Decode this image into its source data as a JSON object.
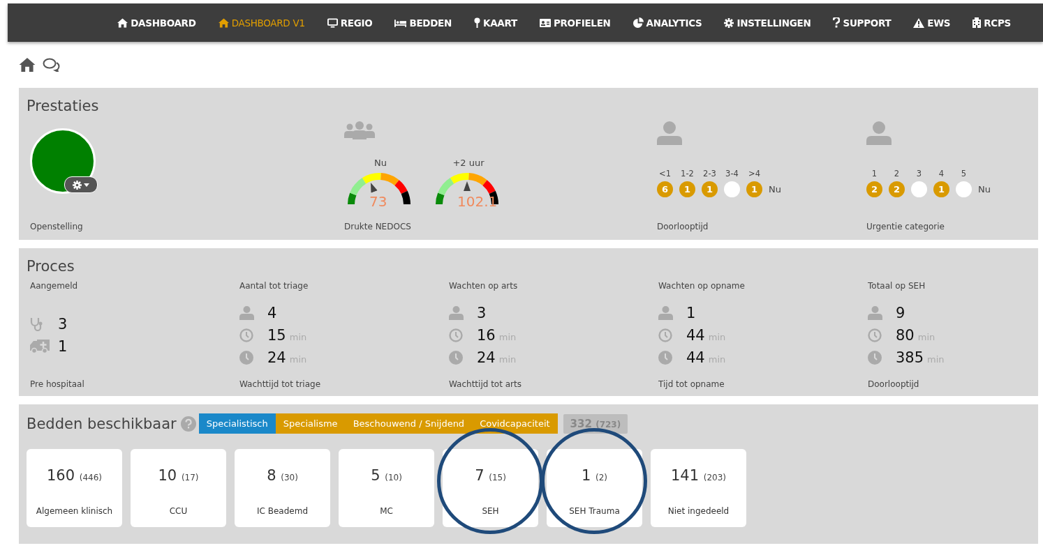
{
  "nav": [
    {
      "kind": "home",
      "label": "DASHBOARD",
      "selected": false
    },
    {
      "kind": "home",
      "label": "DASHBOARD V1",
      "selected": true
    },
    {
      "kind": "monitor",
      "label": "REGIO",
      "selected": false
    },
    {
      "kind": "bed",
      "label": "BEDDEN",
      "selected": false
    },
    {
      "kind": "pin",
      "label": "KAART",
      "selected": false
    },
    {
      "kind": "card",
      "label": "PROFIELEN",
      "selected": false
    },
    {
      "kind": "pie",
      "label": "ANALYTICS",
      "selected": false
    },
    {
      "kind": "gear",
      "label": "INSTELLINGEN",
      "selected": false
    },
    {
      "kind": "question",
      "label": "SUPPORT",
      "selected": false
    },
    {
      "kind": "warning",
      "label": "EWS",
      "selected": false
    },
    {
      "kind": "building",
      "label": "RCPS",
      "selected": false
    }
  ],
  "prestaties": {
    "title": "Prestaties",
    "openstelling": {
      "color": "#008000",
      "label": "Openstelling"
    },
    "drukte": {
      "label": "Drukte NEDOCS",
      "gauges": [
        {
          "caption": "Nu",
          "value": "73"
        },
        {
          "caption": "+2 uur",
          "value": "102.1"
        }
      ]
    },
    "doorlooptijd": {
      "label": "Doorlooptijd",
      "now": "Nu",
      "buckets": [
        {
          "label": "<1",
          "count": "6"
        },
        {
          "label": "1-2",
          "count": "1"
        },
        {
          "label": "2-3",
          "count": "1"
        },
        {
          "label": "3-4"
        },
        {
          "label": ">4",
          "count": "1"
        }
      ]
    },
    "urgentie": {
      "label": "Urgentie categorie",
      "now": "Nu",
      "buckets": [
        {
          "label": "1",
          "count": "2"
        },
        {
          "label": "2",
          "count": "2"
        },
        {
          "label": "3"
        },
        {
          "label": "4",
          "count": "1"
        },
        {
          "label": "5"
        }
      ]
    }
  },
  "proces": {
    "title": "Proces",
    "columns": [
      {
        "title": "Aangemeld",
        "footer": "Pre hospitaal",
        "rows": [
          {
            "kind": "stethoscope",
            "value": "3"
          },
          {
            "kind": "ambulance",
            "value": "1"
          }
        ]
      },
      {
        "title": "Aantal tot triage",
        "footer": "Wachttijd tot triage",
        "rows": [
          {
            "kind": "person",
            "value": "4"
          },
          {
            "kind": "clock",
            "value": "15",
            "unit": "min"
          },
          {
            "kind": "clock-solid",
            "value": "24",
            "unit": "min"
          }
        ]
      },
      {
        "title": "Wachten op arts",
        "footer": "Wachttijd tot arts",
        "rows": [
          {
            "kind": "person",
            "value": "3"
          },
          {
            "kind": "clock",
            "value": "16",
            "unit": "min"
          },
          {
            "kind": "clock-solid",
            "value": "24",
            "unit": "min"
          }
        ]
      },
      {
        "title": "Wachten op opname",
        "footer": "Tijd tot opname",
        "rows": [
          {
            "kind": "person",
            "value": "1"
          },
          {
            "kind": "clock",
            "value": "44",
            "unit": "min"
          },
          {
            "kind": "clock-solid",
            "value": "44",
            "unit": "min"
          }
        ]
      },
      {
        "title": "Totaal op SEH",
        "footer": "Doorlooptijd",
        "rows": [
          {
            "kind": "person",
            "value": "9"
          },
          {
            "kind": "clock",
            "value": "80",
            "unit": "min"
          },
          {
            "kind": "clock-solid",
            "value": "385",
            "unit": "min"
          }
        ]
      }
    ]
  },
  "bedden": {
    "title": "Bedden beschikbaar",
    "tabs": [
      {
        "label": "Specialistisch",
        "selected": true
      },
      {
        "label": "Specialisme",
        "selected": false
      },
      {
        "label": "Beschouwend / Snijdend",
        "selected": false
      },
      {
        "label": "Covidcapaciteit",
        "selected": false
      }
    ],
    "total": "332",
    "total_capacity": "(723)",
    "cards": [
      {
        "value": "160",
        "capacity": "(446)",
        "label": "Algemeen klinisch",
        "circled": false
      },
      {
        "value": "10",
        "capacity": "(17)",
        "label": "CCU",
        "circled": false
      },
      {
        "value": "8",
        "capacity": "(30)",
        "label": "IC Beademd",
        "circled": false
      },
      {
        "value": "5",
        "capacity": "(10)",
        "label": "MC",
        "circled": false
      },
      {
        "value": "7",
        "capacity": "(15)",
        "label": "SEH",
        "circled": true
      },
      {
        "value": "1",
        "capacity": "(2)",
        "label": "SEH Trauma",
        "circled": true
      },
      {
        "value": "141",
        "capacity": "(203)",
        "label": "Niet ingedeeld",
        "circled": false
      }
    ]
  }
}
